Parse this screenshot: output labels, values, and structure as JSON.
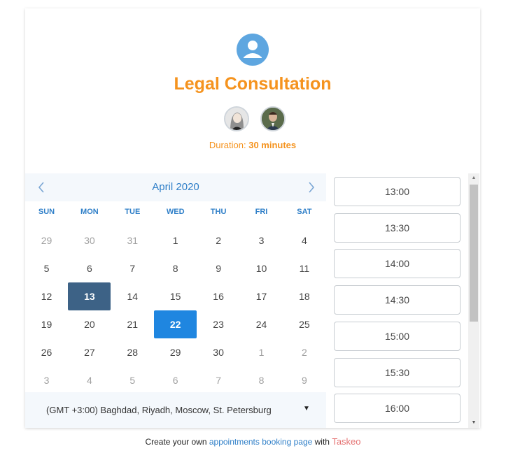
{
  "header": {
    "title": "Legal Consultation",
    "duration_label": "Duration:",
    "duration_value": "30 minutes"
  },
  "calendar": {
    "month_label": "April 2020",
    "weekdays": [
      "SUN",
      "MON",
      "TUE",
      "WED",
      "THU",
      "FRI",
      "SAT"
    ],
    "weeks": [
      [
        "29",
        "30",
        "31",
        "1",
        "2",
        "3",
        "4"
      ],
      [
        "5",
        "6",
        "7",
        "8",
        "9",
        "10",
        "11"
      ],
      [
        "12",
        "13",
        "14",
        "15",
        "16",
        "17",
        "18"
      ],
      [
        "19",
        "20",
        "21",
        "22",
        "23",
        "24",
        "25"
      ],
      [
        "26",
        "27",
        "28",
        "29",
        "30",
        "1",
        "2"
      ],
      [
        "3",
        "4",
        "5",
        "6",
        "7",
        "8",
        "9"
      ]
    ],
    "today": "13",
    "selected": "22",
    "timezone": "(GMT +3:00) Baghdad, Riyadh, Moscow, St. Petersburg"
  },
  "time_slots": [
    "13:00",
    "13:30",
    "14:00",
    "14:30",
    "15:00",
    "15:30",
    "16:00"
  ],
  "footer": {
    "prefix": "Create your own",
    "link": "appointments booking page",
    "with": "with",
    "brand": "Taskeo"
  },
  "colors": {
    "accent_orange": "#f5931e",
    "accent_blue": "#2f7fc8",
    "today_bg": "#3d6286",
    "selected_bg": "#1f86e0"
  },
  "icons": {
    "profile": "user-circle-icon",
    "prev": "chevron-left-icon",
    "next": "chevron-right-icon",
    "dropdown": "caret-down-icon"
  }
}
